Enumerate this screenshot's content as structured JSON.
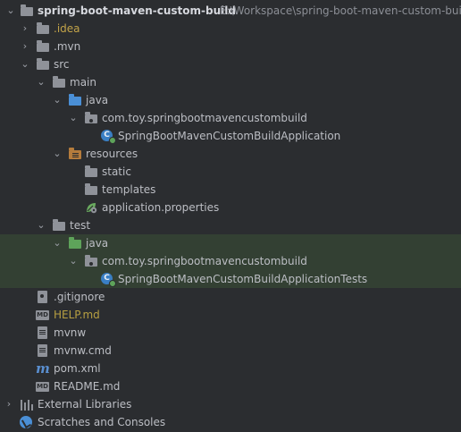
{
  "project": {
    "name": "spring-boot-maven-custom-build",
    "path": "E:\\Workspace\\spring-boot-maven-custom-build"
  },
  "tree": {
    "idea": ".idea",
    "mvn": ".mvn",
    "src": "src",
    "main": "main",
    "main_java": "java",
    "main_package": "com.toy.springbootmavencustombuild",
    "main_class": "SpringBootMavenCustomBuildApplication",
    "resources": "resources",
    "static": "static",
    "templates": "templates",
    "app_props": "application.properties",
    "test": "test",
    "test_java": "java",
    "test_package": "com.toy.springbootmavencustombuild",
    "test_class": "SpringBootMavenCustomBuildApplicationTests",
    "gitignore": ".gitignore",
    "help_md": "HELP.md",
    "mvnw": "mvnw",
    "mvnw_cmd": "mvnw.cmd",
    "pom": "pom.xml",
    "readme": "README.md",
    "external_libraries": "External Libraries",
    "scratches": "Scratches and Consoles"
  },
  "icons": {
    "md_badge": "MD",
    "maven_badge": "m",
    "class_badge": "C"
  },
  "colors": {
    "background": "#2b2d30",
    "test_highlight": "#334033",
    "source_folder": "#4a8fd6",
    "test_folder": "#5ea35a",
    "excluded_text": "#c2a349"
  }
}
